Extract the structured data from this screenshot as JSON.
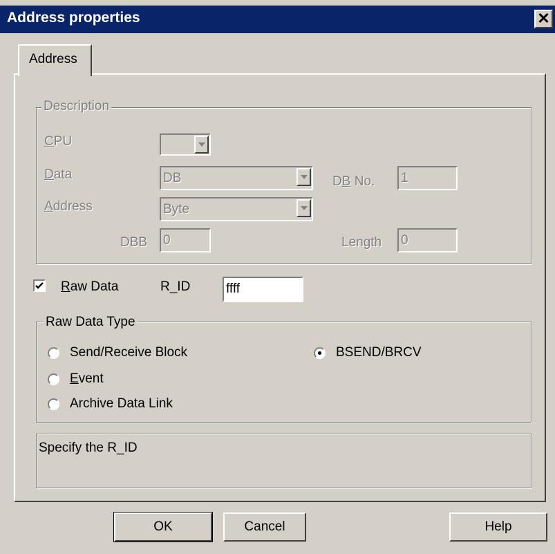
{
  "window": {
    "title": "Address properties",
    "close_glyph": "✕"
  },
  "tabs": [
    {
      "label": "Address"
    }
  ],
  "description": {
    "legend": "Description",
    "cpu_label": "CPU",
    "cpu_value": "",
    "data_label": "Data",
    "data_value": "DB",
    "db_no_label": "DB No.",
    "db_no_value": "1",
    "address_label": "Address",
    "address_value": "Byte",
    "dbb_label": "DBB",
    "dbb_value": "0",
    "length_label": "Length",
    "length_value": "0"
  },
  "raw": {
    "checkbox_label": "Raw Data",
    "checked": true,
    "rid_label": "R_ID",
    "rid_value": "ffff"
  },
  "raw_type": {
    "legend": "Raw Data Type",
    "options": [
      {
        "label": "Send/Receive Block",
        "checked": false
      },
      {
        "label": "Event",
        "checked": false
      },
      {
        "label": "Archive Data Link",
        "checked": false
      },
      {
        "label": "BSEND/BRCV",
        "checked": true
      }
    ]
  },
  "hint": {
    "text": "Specify the R_ID"
  },
  "buttons": {
    "ok": "OK",
    "cancel": "Cancel",
    "help": "Help"
  },
  "colors": {
    "titlebar": "#0a246a",
    "face": "#d4d0c8",
    "disabled_text": "#808080"
  }
}
